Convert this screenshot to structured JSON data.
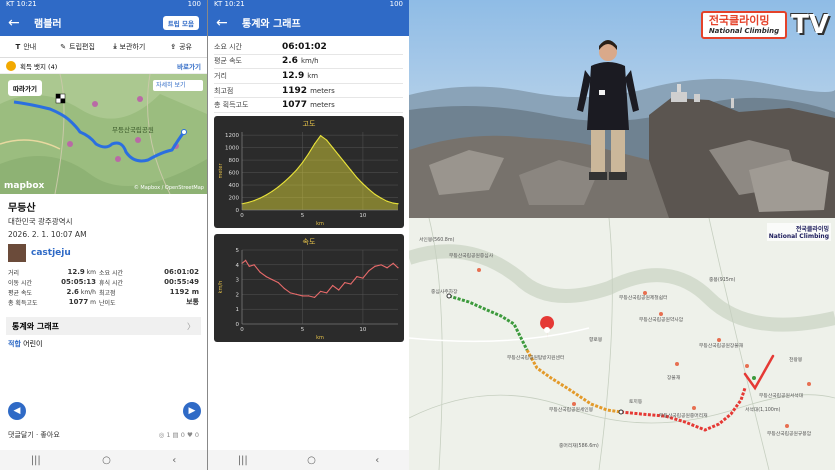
{
  "left_phone": {
    "status_time": "KT 10:21",
    "status_right": "100",
    "back_icon": "←",
    "title": "램블러",
    "save_pill": "트립 모음",
    "toolbar": [
      {
        "icon": "tee-icon",
        "glyph": "T",
        "label": "안내"
      },
      {
        "icon": "pencil-icon",
        "glyph": "✎",
        "label": "트립편집"
      },
      {
        "icon": "download-icon",
        "glyph": "⤓",
        "label": "보관하기"
      },
      {
        "icon": "share-icon",
        "glyph": "⇪",
        "label": "공유"
      }
    ],
    "badges": {
      "label": "획득 뱃지 (4)",
      "link": "바로가기"
    },
    "map": {
      "follow_chip": "따라가기",
      "detail_link": "자세히 보기",
      "park_label": "무등산국립공원",
      "logo": "mapbox",
      "credit": "© Mapbox / OpenStreetMap"
    },
    "mountain": "무등산",
    "location": "대한민국 광주광역시",
    "datetime": "2026. 2. 1. 10:07 AM",
    "username": "castjeju",
    "stats": [
      {
        "l1": "거리",
        "v1": "12.9",
        "u1": "km",
        "l2": "소요 시간",
        "v2": "06:01:02"
      },
      {
        "l1": "이동 시간",
        "v1": "05:05:13",
        "u1": "",
        "l2": "휴식 시간",
        "v2": "00:55:49"
      },
      {
        "l1": "평균 속도",
        "v1": "2.6",
        "u1": "km/h",
        "l2": "최고점",
        "v2": "1192 m"
      },
      {
        "l1": "총 획득고도",
        "v1": "1077",
        "u1": "m",
        "l2": "난이도",
        "v2": "보통"
      }
    ],
    "graph_row": "통계와 그래프",
    "graph_chevron": "〉",
    "suitability": {
      "key": "적합",
      "value": "어린이"
    },
    "comments": {
      "label": "댓글달기 · 좋아요",
      "counts": "◎ 1   ▤ 0   ♥ 0"
    },
    "nav": [
      "|||",
      "○",
      "‹"
    ]
  },
  "middle_phone": {
    "status_time": "KT 10:21",
    "status_right": "100",
    "back_icon": "←",
    "title": "통계와 그래프",
    "stats": [
      {
        "k": "소요 시간",
        "v": "06:01:02",
        "u": ""
      },
      {
        "k": "평균 속도",
        "v": "2.6",
        "u": "km/h"
      },
      {
        "k": "거리",
        "v": "12.9",
        "u": "km"
      },
      {
        "k": "최고점",
        "v": "1192",
        "u": "meters"
      },
      {
        "k": "총 획득고도",
        "v": "1077",
        "u": "meters"
      }
    ],
    "nav": [
      "|||",
      "○",
      "‹"
    ]
  },
  "chart_data": [
    {
      "type": "area",
      "title": "고도",
      "xlabel": "km",
      "ylabel": "meter",
      "xlim": [
        0,
        12.9
      ],
      "ylim": [
        0,
        1250
      ],
      "xticks": [
        0,
        5,
        10
      ],
      "yticks": [
        0,
        200,
        400,
        600,
        800,
        1000,
        1200
      ],
      "grid": true,
      "color": "#e8e23a",
      "x": [
        0,
        0.5,
        1,
        1.5,
        2,
        2.5,
        3,
        3.5,
        4,
        4.5,
        5,
        5.5,
        6,
        6.5,
        7,
        7.5,
        8,
        8.5,
        9,
        9.5,
        10,
        10.5,
        11,
        11.5,
        12,
        12.5,
        12.9
      ],
      "y": [
        100,
        120,
        150,
        190,
        240,
        300,
        370,
        450,
        540,
        640,
        760,
        900,
        1060,
        1190,
        1120,
        1000,
        880,
        760,
        640,
        520,
        420,
        330,
        250,
        190,
        140,
        110,
        100
      ]
    },
    {
      "type": "line",
      "title": "속도",
      "xlabel": "km",
      "ylabel": "km/h",
      "xlim": [
        0,
        12.9
      ],
      "ylim": [
        0,
        5
      ],
      "xticks": [
        0,
        5,
        10
      ],
      "yticks": [
        0,
        1,
        2,
        3,
        4,
        5
      ],
      "grid": true,
      "color": "#e66a6a",
      "x": [
        0,
        0.3,
        0.6,
        1,
        1.5,
        2,
        2.5,
        3,
        3.5,
        4,
        4.5,
        5,
        5.5,
        6,
        6.5,
        7,
        7.5,
        8,
        8.5,
        9,
        9.5,
        10,
        10.5,
        11,
        11.5,
        12,
        12.5,
        12.9
      ],
      "y": [
        4.1,
        4.3,
        3.9,
        4.0,
        3.5,
        3.2,
        3.0,
        2.8,
        2.4,
        2.1,
        2.0,
        1.9,
        1.9,
        1.8,
        2.2,
        2.1,
        2.6,
        2.3,
        2.8,
        2.7,
        3.2,
        3.1,
        3.6,
        3.9,
        4.0,
        3.8,
        4.1,
        3.8
      ]
    }
  ],
  "photo": {
    "channel_kr": "전국클라이밍",
    "channel_en": "National Climbing",
    "tv": "TV",
    "colors": {
      "sky": "#9cc3e6",
      "rock": "#7d7a74",
      "jacket": "#1b1b22"
    }
  },
  "route_map": {
    "channel_kr": "전국클라이밍",
    "channel_en": "National Climbing",
    "labels": [
      "중심사주차장",
      "무등산국립공원탐방지원센터",
      "무등산국립공원제철쉼터",
      "무등산국립공원약사암",
      "토끼등",
      "무등산국립공원세인봉",
      "무등산국립공원중머리재",
      "무등산국립공원장불재",
      "무등산국립공원서석대",
      "무등산국립공원규봉암",
      "무등산국립공원증심사",
      "서인봉(560.8m)",
      "중머리재(586.6m)",
      "장불재",
      "서석대(1,100m)",
      "향로봉",
      "중봉(915m)",
      "천왕봉"
    ],
    "colors": {
      "green": "#3c9a3c",
      "orange": "#e39a2a",
      "red": "#e53935",
      "check": "#e53935"
    }
  }
}
